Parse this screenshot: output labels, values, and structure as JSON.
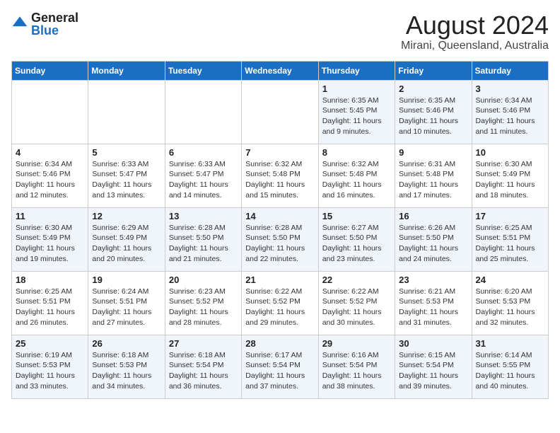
{
  "header": {
    "logo_general": "General",
    "logo_blue": "Blue",
    "month_title": "August 2024",
    "location": "Mirani, Queensland, Australia"
  },
  "days_of_week": [
    "Sunday",
    "Monday",
    "Tuesday",
    "Wednesday",
    "Thursday",
    "Friday",
    "Saturday"
  ],
  "weeks": [
    [
      {
        "day": "",
        "info": ""
      },
      {
        "day": "",
        "info": ""
      },
      {
        "day": "",
        "info": ""
      },
      {
        "day": "",
        "info": ""
      },
      {
        "day": "1",
        "info": "Sunrise: 6:35 AM\nSunset: 5:45 PM\nDaylight: 11 hours\nand 9 minutes."
      },
      {
        "day": "2",
        "info": "Sunrise: 6:35 AM\nSunset: 5:46 PM\nDaylight: 11 hours\nand 10 minutes."
      },
      {
        "day": "3",
        "info": "Sunrise: 6:34 AM\nSunset: 5:46 PM\nDaylight: 11 hours\nand 11 minutes."
      }
    ],
    [
      {
        "day": "4",
        "info": "Sunrise: 6:34 AM\nSunset: 5:46 PM\nDaylight: 11 hours\nand 12 minutes."
      },
      {
        "day": "5",
        "info": "Sunrise: 6:33 AM\nSunset: 5:47 PM\nDaylight: 11 hours\nand 13 minutes."
      },
      {
        "day": "6",
        "info": "Sunrise: 6:33 AM\nSunset: 5:47 PM\nDaylight: 11 hours\nand 14 minutes."
      },
      {
        "day": "7",
        "info": "Sunrise: 6:32 AM\nSunset: 5:48 PM\nDaylight: 11 hours\nand 15 minutes."
      },
      {
        "day": "8",
        "info": "Sunrise: 6:32 AM\nSunset: 5:48 PM\nDaylight: 11 hours\nand 16 minutes."
      },
      {
        "day": "9",
        "info": "Sunrise: 6:31 AM\nSunset: 5:48 PM\nDaylight: 11 hours\nand 17 minutes."
      },
      {
        "day": "10",
        "info": "Sunrise: 6:30 AM\nSunset: 5:49 PM\nDaylight: 11 hours\nand 18 minutes."
      }
    ],
    [
      {
        "day": "11",
        "info": "Sunrise: 6:30 AM\nSunset: 5:49 PM\nDaylight: 11 hours\nand 19 minutes."
      },
      {
        "day": "12",
        "info": "Sunrise: 6:29 AM\nSunset: 5:49 PM\nDaylight: 11 hours\nand 20 minutes."
      },
      {
        "day": "13",
        "info": "Sunrise: 6:28 AM\nSunset: 5:50 PM\nDaylight: 11 hours\nand 21 minutes."
      },
      {
        "day": "14",
        "info": "Sunrise: 6:28 AM\nSunset: 5:50 PM\nDaylight: 11 hours\nand 22 minutes."
      },
      {
        "day": "15",
        "info": "Sunrise: 6:27 AM\nSunset: 5:50 PM\nDaylight: 11 hours\nand 23 minutes."
      },
      {
        "day": "16",
        "info": "Sunrise: 6:26 AM\nSunset: 5:50 PM\nDaylight: 11 hours\nand 24 minutes."
      },
      {
        "day": "17",
        "info": "Sunrise: 6:25 AM\nSunset: 5:51 PM\nDaylight: 11 hours\nand 25 minutes."
      }
    ],
    [
      {
        "day": "18",
        "info": "Sunrise: 6:25 AM\nSunset: 5:51 PM\nDaylight: 11 hours\nand 26 minutes."
      },
      {
        "day": "19",
        "info": "Sunrise: 6:24 AM\nSunset: 5:51 PM\nDaylight: 11 hours\nand 27 minutes."
      },
      {
        "day": "20",
        "info": "Sunrise: 6:23 AM\nSunset: 5:52 PM\nDaylight: 11 hours\nand 28 minutes."
      },
      {
        "day": "21",
        "info": "Sunrise: 6:22 AM\nSunset: 5:52 PM\nDaylight: 11 hours\nand 29 minutes."
      },
      {
        "day": "22",
        "info": "Sunrise: 6:22 AM\nSunset: 5:52 PM\nDaylight: 11 hours\nand 30 minutes."
      },
      {
        "day": "23",
        "info": "Sunrise: 6:21 AM\nSunset: 5:53 PM\nDaylight: 11 hours\nand 31 minutes."
      },
      {
        "day": "24",
        "info": "Sunrise: 6:20 AM\nSunset: 5:53 PM\nDaylight: 11 hours\nand 32 minutes."
      }
    ],
    [
      {
        "day": "25",
        "info": "Sunrise: 6:19 AM\nSunset: 5:53 PM\nDaylight: 11 hours\nand 33 minutes."
      },
      {
        "day": "26",
        "info": "Sunrise: 6:18 AM\nSunset: 5:53 PM\nDaylight: 11 hours\nand 34 minutes."
      },
      {
        "day": "27",
        "info": "Sunrise: 6:18 AM\nSunset: 5:54 PM\nDaylight: 11 hours\nand 36 minutes."
      },
      {
        "day": "28",
        "info": "Sunrise: 6:17 AM\nSunset: 5:54 PM\nDaylight: 11 hours\nand 37 minutes."
      },
      {
        "day": "29",
        "info": "Sunrise: 6:16 AM\nSunset: 5:54 PM\nDaylight: 11 hours\nand 38 minutes."
      },
      {
        "day": "30",
        "info": "Sunrise: 6:15 AM\nSunset: 5:54 PM\nDaylight: 11 hours\nand 39 minutes."
      },
      {
        "day": "31",
        "info": "Sunrise: 6:14 AM\nSunset: 5:55 PM\nDaylight: 11 hours\nand 40 minutes."
      }
    ]
  ]
}
